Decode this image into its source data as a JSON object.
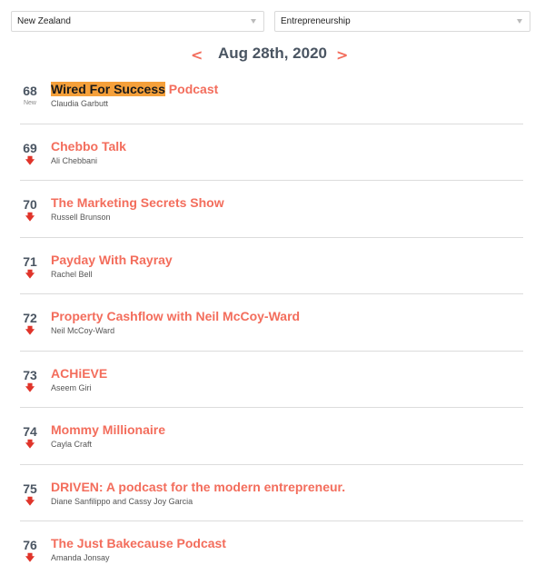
{
  "filters": {
    "country": "New Zealand",
    "genre": "Entrepreneurship"
  },
  "date_nav": {
    "prev": "<",
    "date": "Aug 28th, 2020",
    "next": ">"
  },
  "podcasts": [
    {
      "rank": "68",
      "movement": "New",
      "title_highlight": "Wired For Success",
      "title_rest": " Podcast",
      "author": "Claudia Garbutt"
    },
    {
      "rank": "69",
      "movement": "down",
      "title": "Chebbo Talk",
      "author": "Ali Chebbani"
    },
    {
      "rank": "70",
      "movement": "down",
      "title": "The Marketing Secrets Show",
      "author": "Russell Brunson"
    },
    {
      "rank": "71",
      "movement": "down",
      "title": "Payday With Rayray",
      "author": "Rachel Bell"
    },
    {
      "rank": "72",
      "movement": "down",
      "title": "Property Cashflow with Neil McCoy-Ward",
      "author": "Neil McCoy-Ward"
    },
    {
      "rank": "73",
      "movement": "down",
      "title": "ACHiEVE",
      "author": "Aseem Giri"
    },
    {
      "rank": "74",
      "movement": "down",
      "title": "Mommy Millionaire",
      "author": "Cayla Craft"
    },
    {
      "rank": "75",
      "movement": "down",
      "title": "DRIVEN: A podcast for the modern entrepreneur.",
      "author": "Diane Sanfilippo and Cassy Joy Garcia"
    },
    {
      "rank": "76",
      "movement": "down",
      "title": "The Just Bakecause Podcast",
      "author": "Amanda Jonsay"
    }
  ],
  "icons": {
    "down": "arrow-down-icon",
    "caret": "caret-down-icon"
  },
  "colors": {
    "accent": "#f36d5c",
    "highlight": "#f5a03a",
    "down": "#e0342a",
    "rank": "#4a5562"
  }
}
